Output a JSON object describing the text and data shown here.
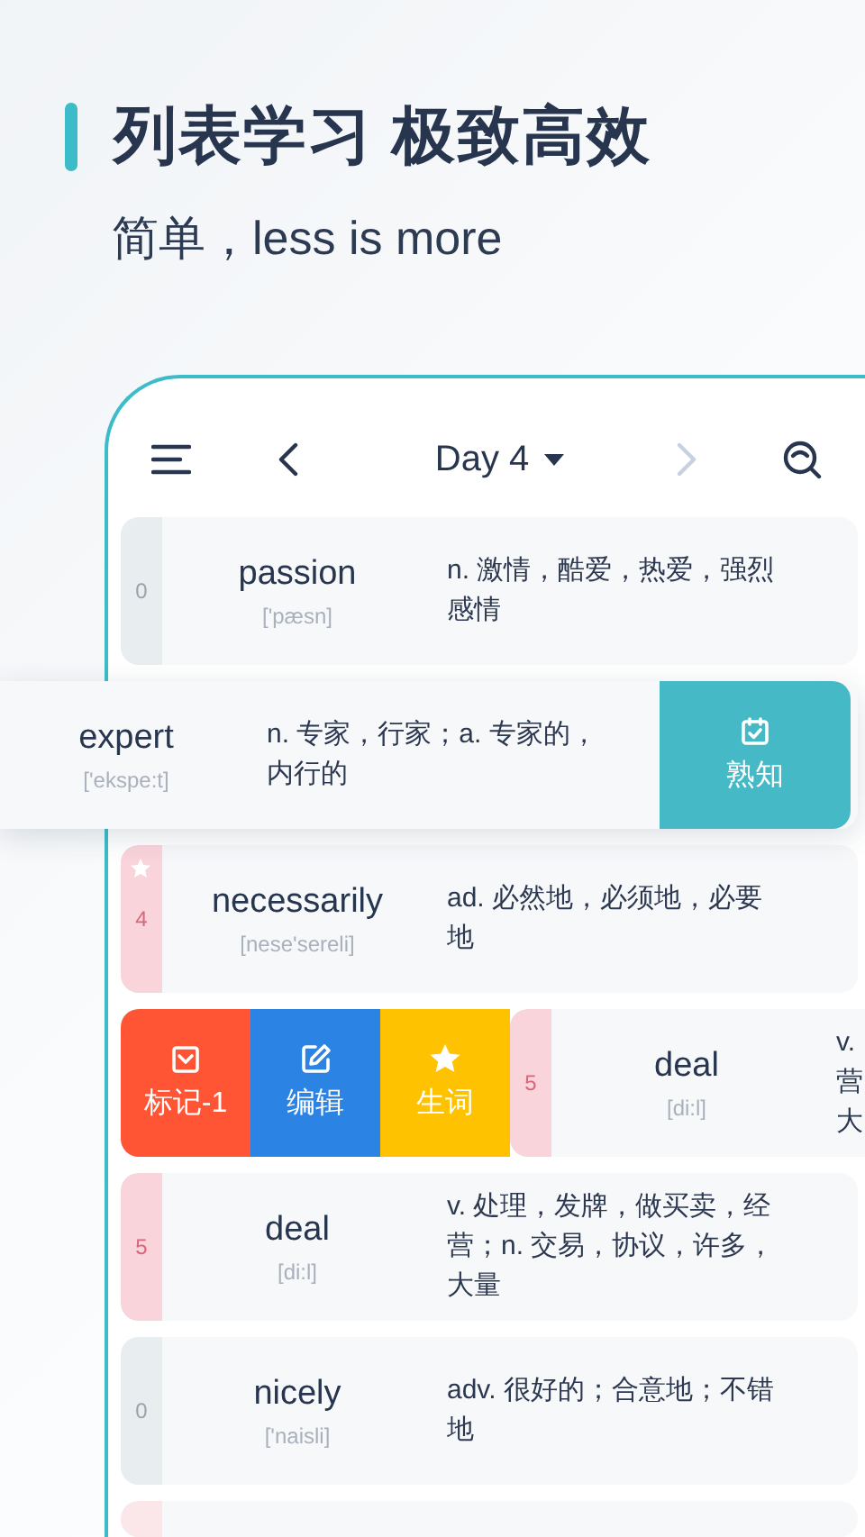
{
  "header": {
    "title": "列表学习 极致高效",
    "subtitle": "简单，less is more"
  },
  "toolbar": {
    "title": "Day 4",
    "prev_disabled": false,
    "next_disabled": true
  },
  "rows": [
    {
      "kind": "normal",
      "count": "0",
      "color": "#e8eef0",
      "starred": false,
      "word": "passion",
      "phonetic": "['pæsn]",
      "definition": "n. 激情，酷爱，热爱，强烈感情"
    },
    {
      "kind": "lifted",
      "word": "expert",
      "phonetic": "['ekspe:t]",
      "definition": "n. 专家，行家；a. 专家的，内行的",
      "actions": [
        {
          "kind": "known",
          "label": "熟知",
          "color": "#45bac6"
        }
      ]
    },
    {
      "kind": "normal",
      "count": "4",
      "color": "#f9d4da",
      "starred": true,
      "word": "necessarily",
      "phonetic": "[nese'sereli]",
      "definition": "ad. 必然地，必须地，必要地"
    },
    {
      "kind": "swiped",
      "count": "5",
      "color": "#f9d4da",
      "starred": false,
      "word": "deal",
      "phonetic": "[di:l]",
      "definition_lines": [
        "v.",
        "营",
        "大"
      ],
      "actions": [
        {
          "kind": "mark",
          "label": "标记-1",
          "color": "#ff5534"
        },
        {
          "kind": "edit",
          "label": "编辑",
          "color": "#2b83e4"
        },
        {
          "kind": "star",
          "label": "生词",
          "color": "#ffc200"
        }
      ]
    },
    {
      "kind": "normal",
      "count": "5",
      "color": "#f9d4da",
      "starred": false,
      "word": "deal",
      "phonetic": "[di:l]",
      "definition": "v. 处理，发牌，做买卖，经营；n. 交易，协议，许多，大量"
    },
    {
      "kind": "normal",
      "count": "0",
      "color": "#e8eef0",
      "starred": false,
      "word": "nicely",
      "phonetic": "['naisli]",
      "definition": "adv. 很好的；合意地；不错地"
    },
    {
      "kind": "partial",
      "color": "#fbe6e9"
    }
  ]
}
